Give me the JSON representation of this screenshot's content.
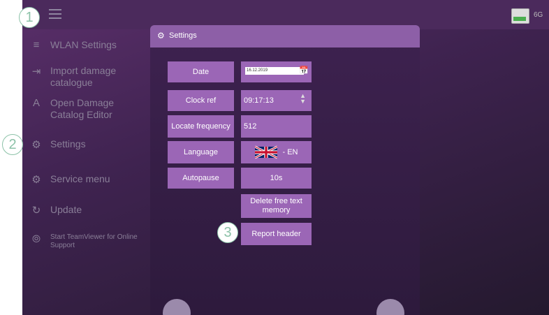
{
  "sidebar": {
    "items": [
      {
        "label": "WLAN Settings",
        "icon": "wlan-icon",
        "glyph": "≡"
      },
      {
        "label": "Import damage catalogue",
        "icon": "import-icon",
        "glyph": "⇥"
      },
      {
        "label": "Open Damage Catalog Editor",
        "icon": "editor-icon",
        "glyph": "A"
      },
      {
        "label": "Settings",
        "icon": "gear-icon",
        "glyph": "⚙"
      },
      {
        "label": "Service menu",
        "icon": "gears-icon",
        "glyph": "⚙"
      },
      {
        "label": "Update",
        "icon": "refresh-icon",
        "glyph": "↻"
      },
      {
        "label": "Start TeamViewer for Online Support",
        "icon": "teamviewer-icon",
        "glyph": "⦾"
      }
    ]
  },
  "status": {
    "battery_label": "6G"
  },
  "dialog": {
    "title": "Settings",
    "date_label": "Date",
    "date_value": "16.12.2019",
    "clock_label": "Clock ref",
    "clock_value": "09:17:13",
    "locate_label": "Locate frequency",
    "locate_value": "512",
    "language_label": "Language",
    "language_value": "- EN",
    "autopause_label": "Autopause",
    "autopause_value": "10s",
    "delete_label": "Delete free text memory",
    "report_label": "Report header"
  },
  "callouts": [
    "1",
    "2",
    "3"
  ],
  "colors": {
    "accent": "#9b66b6",
    "header": "#8d5fa7",
    "callout": "#8cc2a8"
  }
}
